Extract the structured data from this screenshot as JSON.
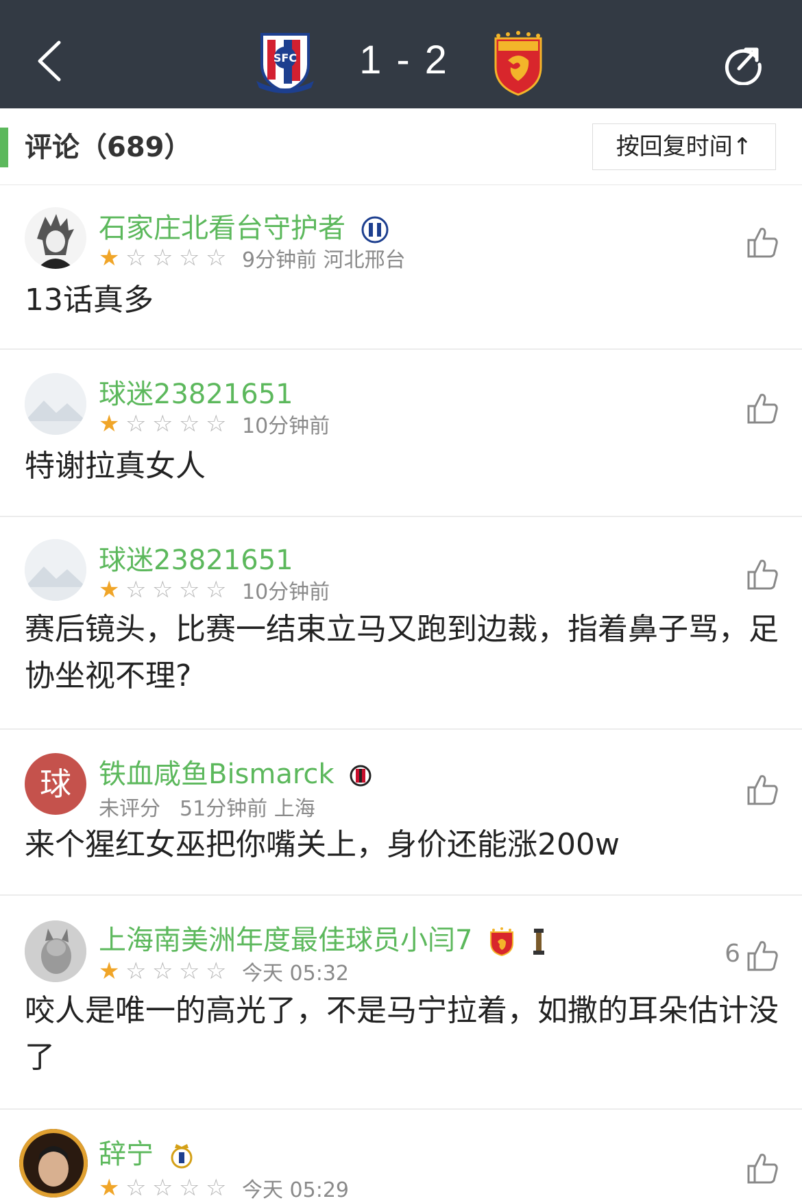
{
  "header": {
    "score": {
      "home": "1",
      "separator": "-",
      "away": "2"
    },
    "home_crest_text": "SFC",
    "icons": {
      "back": "chevron-left-icon",
      "share": "share-icon"
    }
  },
  "comments_section": {
    "title": "评论（689）",
    "sort_label": "按回复时间↑"
  },
  "comments": [
    {
      "username": "石家庄北看台守护者",
      "rating": 1,
      "rating_text": "",
      "time": "9分钟前",
      "location": "河北邢台",
      "text": "13话真多",
      "likes": ""
    },
    {
      "username": "球迷23821651",
      "rating": 1,
      "rating_text": "",
      "time": "10分钟前",
      "location": "",
      "text": "特谢拉真女人",
      "likes": ""
    },
    {
      "username": "球迷23821651",
      "rating": 1,
      "rating_text": "",
      "time": "10分钟前",
      "location": "",
      "text": "赛后镜头，比赛一结束立马又跑到边裁，指着鼻子骂，足协坐视不理?",
      "likes": ""
    },
    {
      "username": "铁血咸鱼Bismarck",
      "rating": 0,
      "rating_text": "未评分",
      "time": "51分钟前",
      "location": "上海",
      "text": "来个猩红女巫把你嘴关上，身价还能涨200w",
      "likes": "",
      "avatar_initial": "球"
    },
    {
      "username": "上海南美洲年度最佳球员小闫7",
      "rating": 1,
      "rating_text": "",
      "time": "今天 05:32",
      "location": "",
      "text": "咬人是唯一的高光了，不是马宁拉着，如撒的耳朵估计没了",
      "likes": "6"
    },
    {
      "username": "辞宁",
      "rating": 1,
      "rating_text": "",
      "time": "今天 05:29",
      "location": "",
      "text": "",
      "likes": ""
    }
  ],
  "colors": {
    "header_bg": "#333a44",
    "accent_green": "#5cb85c",
    "star_on": "#f0a528",
    "star_off": "#b5b5b5"
  }
}
